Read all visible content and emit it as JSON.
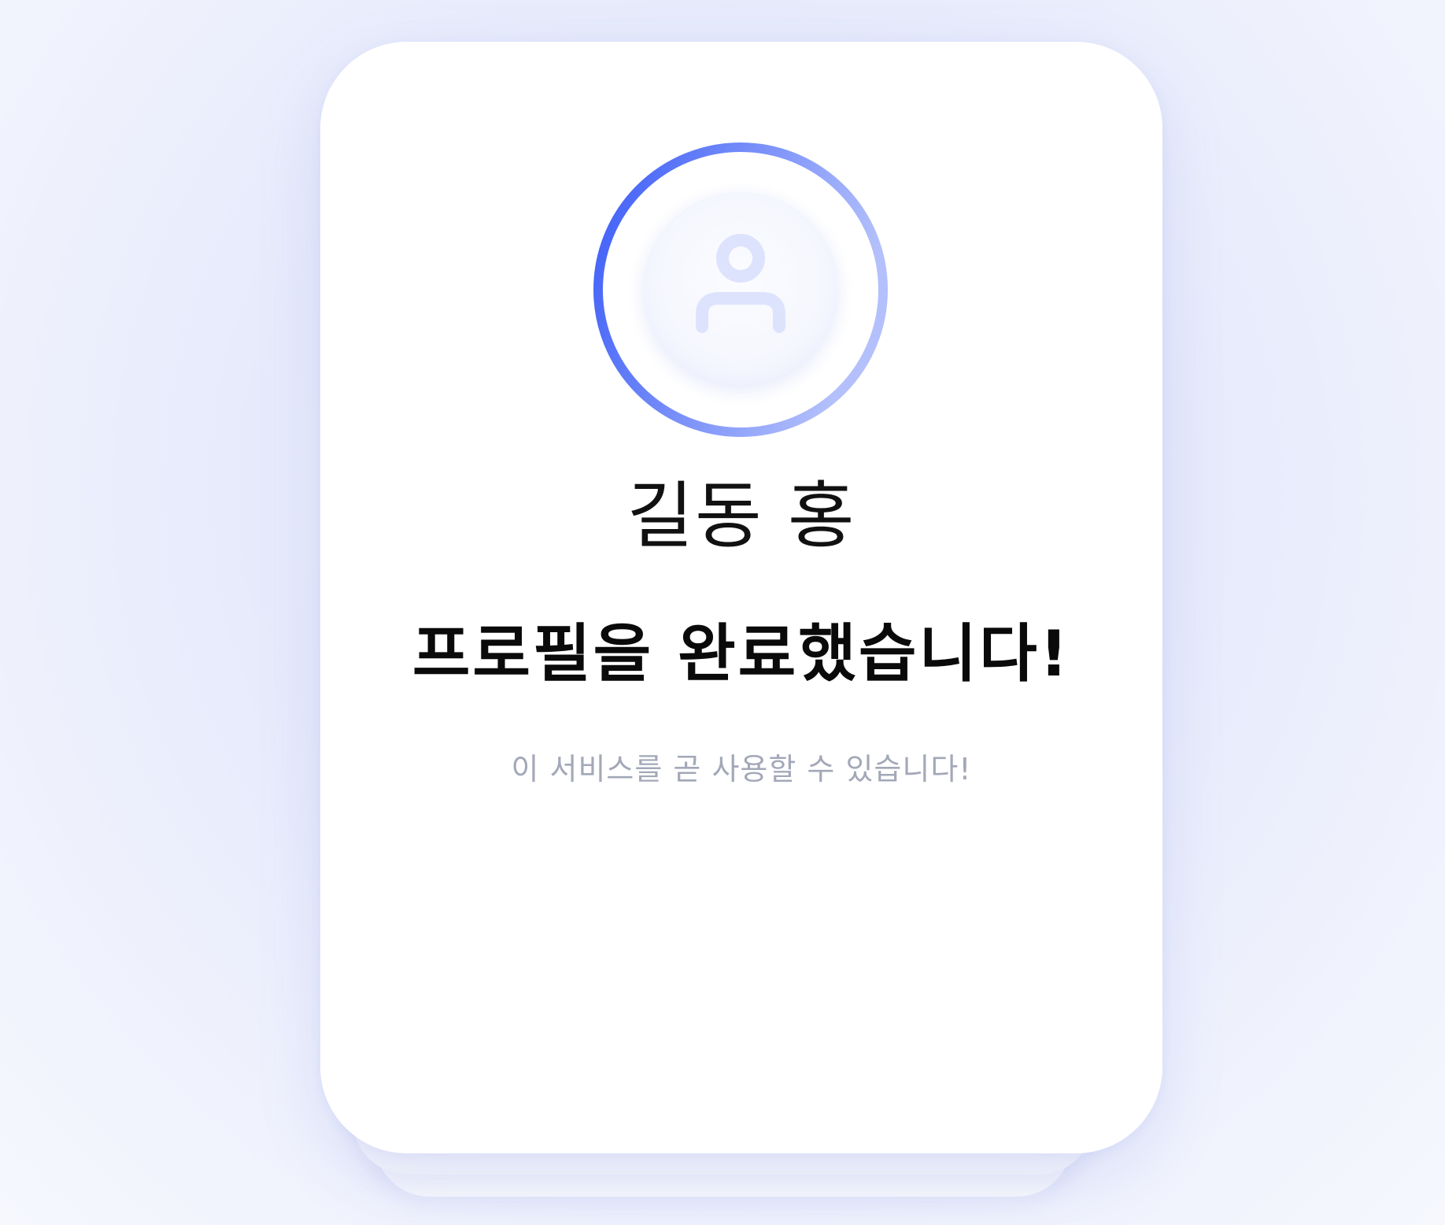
{
  "profile": {
    "display_name": "길동 홍",
    "avatar_icon": "user-icon"
  },
  "status": {
    "title": "프로필을 완료했습니다!",
    "subtitle": "이 서비스를 곧 사용할 수 있습니다!"
  },
  "colors": {
    "page_background": "#e8ebfc",
    "card_background": "#ffffff",
    "ring_start": "#3c5cf7",
    "ring_end": "#b3c0fb",
    "avatar_icon": "#dde3fd",
    "title_text": "#0a0a0a",
    "subtitle_text": "#a3a8b8"
  }
}
